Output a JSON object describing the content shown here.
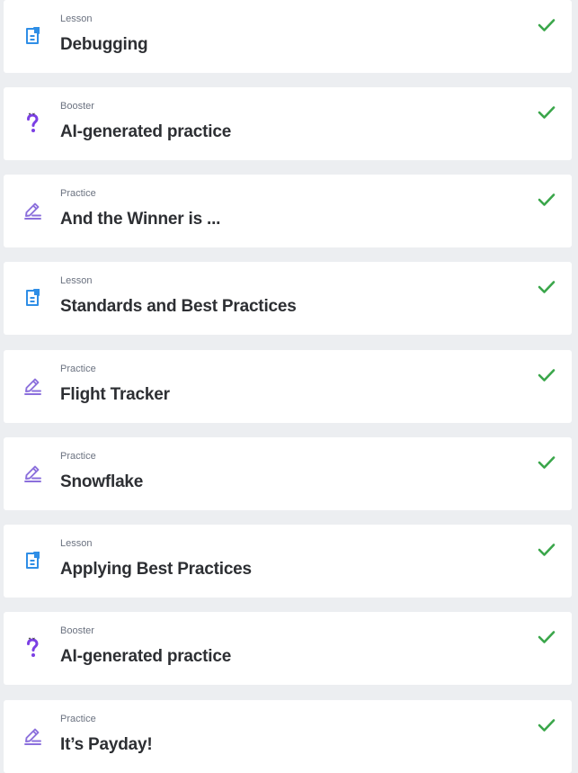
{
  "colors": {
    "lesson": "#2f8ee6",
    "booster": "#7b3fe4",
    "practice": "#8b6fdc",
    "check": "#3aa64a"
  },
  "items": [
    {
      "type": "Lesson",
      "title": "Debugging",
      "icon": "lesson-document-icon",
      "completed": true
    },
    {
      "type": "Booster",
      "title": "AI-generated practice",
      "icon": "booster-question-icon",
      "completed": true
    },
    {
      "type": "Practice",
      "title": "And the Winner is ...",
      "icon": "practice-pencil-icon",
      "completed": true
    },
    {
      "type": "Lesson",
      "title": "Standards and Best Practices",
      "icon": "lesson-document-icon",
      "completed": true
    },
    {
      "type": "Practice",
      "title": "Flight Tracker",
      "icon": "practice-pencil-icon",
      "completed": true
    },
    {
      "type": "Practice",
      "title": "Snowflake",
      "icon": "practice-pencil-icon",
      "completed": true
    },
    {
      "type": "Lesson",
      "title": "Applying Best Practices",
      "icon": "lesson-document-icon",
      "completed": true
    },
    {
      "type": "Booster",
      "title": "AI-generated practice",
      "icon": "booster-question-icon",
      "completed": true
    },
    {
      "type": "Practice",
      "title": "It’s Payday!",
      "icon": "practice-pencil-icon",
      "completed": true
    }
  ]
}
